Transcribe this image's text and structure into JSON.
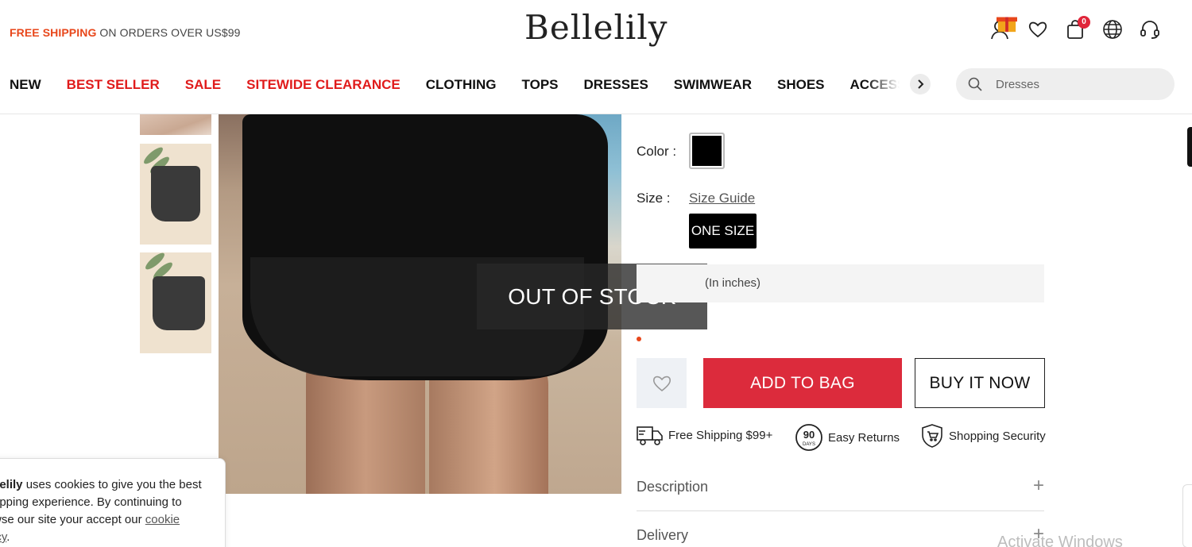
{
  "promo": {
    "highlight": "FREE SHIPPING",
    "rest": " ON ORDERS OVER US$99"
  },
  "brand": {
    "logo": "Bellelily"
  },
  "header": {
    "cart_count": "0"
  },
  "nav": {
    "items": [
      {
        "label": "NEW",
        "red": false
      },
      {
        "label": "BEST SELLER",
        "red": true
      },
      {
        "label": "SALE",
        "red": true
      },
      {
        "label": "SITEWIDE CLEARANCE",
        "red": true
      },
      {
        "label": "CLOTHING",
        "red": false
      },
      {
        "label": "TOPS",
        "red": false
      },
      {
        "label": "DRESSES",
        "red": false
      },
      {
        "label": "SWIMWEAR",
        "red": false
      },
      {
        "label": "SHOES",
        "red": false
      },
      {
        "label": "ACCESSORIES",
        "red": false
      }
    ],
    "search_value": "Dresses"
  },
  "product": {
    "stock_overlay": "OUT OF STOCK",
    "color_label": "Color :",
    "selected_color": "#000000",
    "size_label": "Size :",
    "size_guide": "Size Guide",
    "selected_size": "ONE SIZE",
    "size_unit_note": "(In inches)"
  },
  "actions": {
    "add_to_bag": "ADD TO BAG",
    "buy_now": "BUY IT NOW"
  },
  "features": [
    {
      "label": "Free Shipping $99+",
      "icon": "truck-icon"
    },
    {
      "label": "Easy Returns",
      "icon": "90-days-icon",
      "badge_num": "90",
      "badge_text": "DAYS"
    },
    {
      "label": "Shopping Security",
      "icon": "shield-cart-icon"
    }
  ],
  "accordion": [
    {
      "title": "Description",
      "toggle": "+"
    },
    {
      "title": "Delivery",
      "toggle": "+"
    }
  ],
  "cookie": {
    "brand_part": "llelily",
    "line1": " uses cookies to give you the best",
    "line2": "opping experience. By continuing to",
    "line3": "wse our site your accept our ",
    "link1": "cookie",
    "link2": "icy",
    "end": "."
  },
  "watermark": "Activate Windows",
  "colors": {
    "accent_red": "#dc2b3c",
    "promo_orange": "#e8471b",
    "nav_red": "#e01b1b"
  }
}
